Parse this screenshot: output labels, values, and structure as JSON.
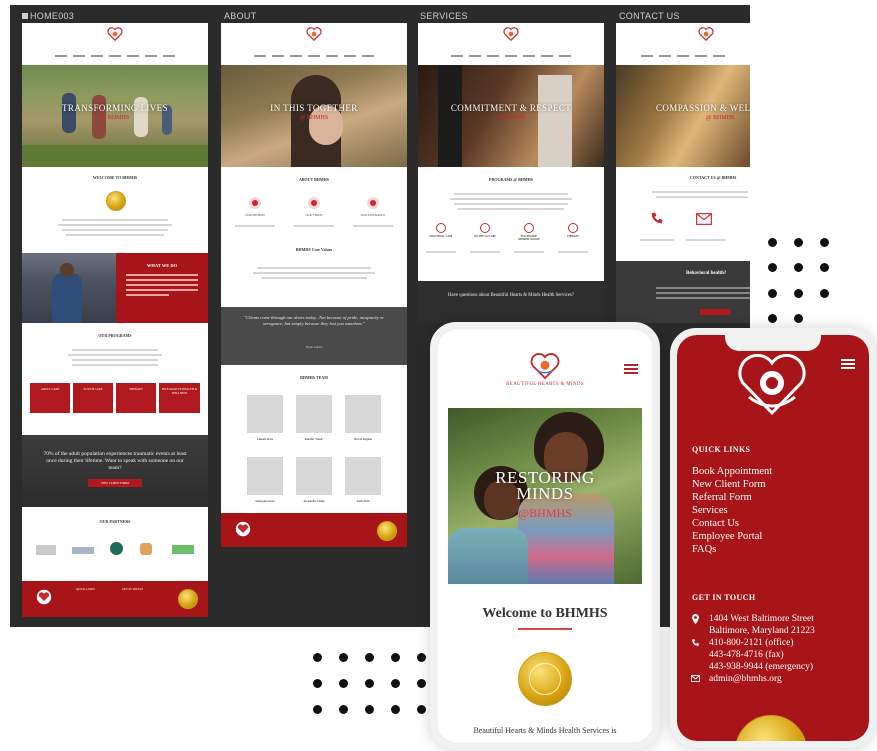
{
  "board": {
    "labels": [
      "HOME003",
      "ABOUT",
      "SERVICES",
      "CONTACT US"
    ]
  },
  "home": {
    "hero_title": "TRANSFORMING LIVES",
    "hero_sub": "@ BHMHS",
    "welcome": "WELCOME TO BHMHS",
    "what_we_do": "WHAT WE DO",
    "programs_title": "OUR PROGRAMS",
    "programs": [
      "ADULT CARE",
      "YOUTH CARE",
      "THERAPY",
      "INTEGRATIVE HEALTH & WELLNESS"
    ],
    "quote": "70% of the adult population experiences traumatic events at least once during their lifetime. Want to speak with someone on our team?",
    "quote_button": "NEW CLIENT FORM",
    "partners_title": "OUR PARTNERS",
    "footer_quick_links": "QUICK LINKS",
    "footer_get_in_touch": "GET IN TOUCH"
  },
  "about": {
    "hero_title": "IN THIS TOGETHER",
    "hero_sub": "@ BHMHS",
    "section_title": "ABOUT BHMHS",
    "icons": [
      "OUR MISSION",
      "OUR VISION",
      "OUR ASSURANCE"
    ],
    "core_values": "BHMHS Core Values",
    "quote": "\"Clients come through our doors today.. Not because of pride, incapacity or arrogance, but simply because they lost you somehow.\"",
    "quote_author": "Marin Guillot",
    "team_title": "BHMHS TEAM",
    "team": [
      "Lakeela Rose",
      "Jennifer \"Jenni\"",
      "Nicole English",
      "Sakeeyah Green",
      "Alexandra Clarke",
      "Tasha Kim"
    ]
  },
  "services": {
    "hero_title": "COMMITMENT & RESPECT",
    "hero_sub": "@ BHMHS",
    "section_title": "PROGRAMS @ BHMHS",
    "items": [
      "INDIVIDUAL CARE",
      "ON-THE-GO CARE",
      "PSYCHIATRIC REHABILITATION",
      "THERAPY"
    ],
    "question": "Have questions about Beautiful Hearts & Minds Health Services?"
  },
  "contact": {
    "hero_title": "COMPASSION & WELLNESS",
    "hero_sub": "@ BHMHS",
    "section_title": "CONTACT US @ BHMHS",
    "behavioral": "Behavioral health?"
  },
  "phone1": {
    "brand": "BEAUTIFUL HEARTS & MINDS",
    "hero_title_1": "RESTORING",
    "hero_title_2": "MINDS",
    "hero_sub": "@BHMHS",
    "welcome": "Welcome to BHMHS",
    "body": "Beautiful Hearts & Minds Health Services is"
  },
  "phone2": {
    "quick_links_title": "QUICK LINKS",
    "quick_links": [
      "Book Appointment",
      "New Client Form",
      "Referral Form",
      "Services",
      "Contact Us",
      "Employee Portal",
      "FAQs"
    ],
    "get_in_touch_title": "GET IN TOUCH",
    "address_1": "1404 West Baltimore Street",
    "address_2": "Baltimore, Maryland 21223",
    "phone_office": "410-800-2121 (office)",
    "phone_fax": "443-478-4716 (fax)",
    "phone_emergency": "443-938-9944 (emergency)",
    "email": "admin@bhmhs.org"
  },
  "colors": {
    "brand_red": "#a71518",
    "board_bg": "#2b2b2b",
    "gold": "#d9a514"
  }
}
